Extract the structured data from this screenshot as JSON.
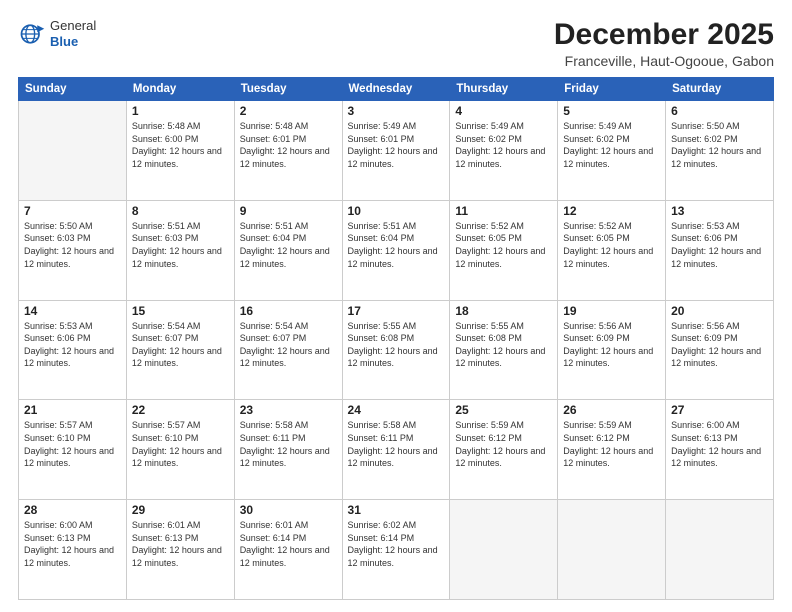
{
  "header": {
    "logo": {
      "general": "General",
      "blue": "Blue"
    },
    "title": "December 2025",
    "subtitle": "Franceville, Haut-Ogooue, Gabon"
  },
  "days_of_week": [
    "Sunday",
    "Monday",
    "Tuesday",
    "Wednesday",
    "Thursday",
    "Friday",
    "Saturday"
  ],
  "weeks": [
    [
      {
        "day": "",
        "empty": true
      },
      {
        "day": "1",
        "sunrise": "5:48 AM",
        "sunset": "6:00 PM",
        "daylight": "12 hours and 12 minutes."
      },
      {
        "day": "2",
        "sunrise": "5:48 AM",
        "sunset": "6:01 PM",
        "daylight": "12 hours and 12 minutes."
      },
      {
        "day": "3",
        "sunrise": "5:49 AM",
        "sunset": "6:01 PM",
        "daylight": "12 hours and 12 minutes."
      },
      {
        "day": "4",
        "sunrise": "5:49 AM",
        "sunset": "6:02 PM",
        "daylight": "12 hours and 12 minutes."
      },
      {
        "day": "5",
        "sunrise": "5:49 AM",
        "sunset": "6:02 PM",
        "daylight": "12 hours and 12 minutes."
      },
      {
        "day": "6",
        "sunrise": "5:50 AM",
        "sunset": "6:02 PM",
        "daylight": "12 hours and 12 minutes."
      }
    ],
    [
      {
        "day": "7",
        "sunrise": "5:50 AM",
        "sunset": "6:03 PM",
        "daylight": "12 hours and 12 minutes."
      },
      {
        "day": "8",
        "sunrise": "5:51 AM",
        "sunset": "6:03 PM",
        "daylight": "12 hours and 12 minutes."
      },
      {
        "day": "9",
        "sunrise": "5:51 AM",
        "sunset": "6:04 PM",
        "daylight": "12 hours and 12 minutes."
      },
      {
        "day": "10",
        "sunrise": "5:51 AM",
        "sunset": "6:04 PM",
        "daylight": "12 hours and 12 minutes."
      },
      {
        "day": "11",
        "sunrise": "5:52 AM",
        "sunset": "6:05 PM",
        "daylight": "12 hours and 12 minutes."
      },
      {
        "day": "12",
        "sunrise": "5:52 AM",
        "sunset": "6:05 PM",
        "daylight": "12 hours and 12 minutes."
      },
      {
        "day": "13",
        "sunrise": "5:53 AM",
        "sunset": "6:06 PM",
        "daylight": "12 hours and 12 minutes."
      }
    ],
    [
      {
        "day": "14",
        "sunrise": "5:53 AM",
        "sunset": "6:06 PM",
        "daylight": "12 hours and 12 minutes."
      },
      {
        "day": "15",
        "sunrise": "5:54 AM",
        "sunset": "6:07 PM",
        "daylight": "12 hours and 12 minutes."
      },
      {
        "day": "16",
        "sunrise": "5:54 AM",
        "sunset": "6:07 PM",
        "daylight": "12 hours and 12 minutes."
      },
      {
        "day": "17",
        "sunrise": "5:55 AM",
        "sunset": "6:08 PM",
        "daylight": "12 hours and 12 minutes."
      },
      {
        "day": "18",
        "sunrise": "5:55 AM",
        "sunset": "6:08 PM",
        "daylight": "12 hours and 12 minutes."
      },
      {
        "day": "19",
        "sunrise": "5:56 AM",
        "sunset": "6:09 PM",
        "daylight": "12 hours and 12 minutes."
      },
      {
        "day": "20",
        "sunrise": "5:56 AM",
        "sunset": "6:09 PM",
        "daylight": "12 hours and 12 minutes."
      }
    ],
    [
      {
        "day": "21",
        "sunrise": "5:57 AM",
        "sunset": "6:10 PM",
        "daylight": "12 hours and 12 minutes."
      },
      {
        "day": "22",
        "sunrise": "5:57 AM",
        "sunset": "6:10 PM",
        "daylight": "12 hours and 12 minutes."
      },
      {
        "day": "23",
        "sunrise": "5:58 AM",
        "sunset": "6:11 PM",
        "daylight": "12 hours and 12 minutes."
      },
      {
        "day": "24",
        "sunrise": "5:58 AM",
        "sunset": "6:11 PM",
        "daylight": "12 hours and 12 minutes."
      },
      {
        "day": "25",
        "sunrise": "5:59 AM",
        "sunset": "6:12 PM",
        "daylight": "12 hours and 12 minutes."
      },
      {
        "day": "26",
        "sunrise": "5:59 AM",
        "sunset": "6:12 PM",
        "daylight": "12 hours and 12 minutes."
      },
      {
        "day": "27",
        "sunrise": "6:00 AM",
        "sunset": "6:13 PM",
        "daylight": "12 hours and 12 minutes."
      }
    ],
    [
      {
        "day": "28",
        "sunrise": "6:00 AM",
        "sunset": "6:13 PM",
        "daylight": "12 hours and 12 minutes."
      },
      {
        "day": "29",
        "sunrise": "6:01 AM",
        "sunset": "6:13 PM",
        "daylight": "12 hours and 12 minutes."
      },
      {
        "day": "30",
        "sunrise": "6:01 AM",
        "sunset": "6:14 PM",
        "daylight": "12 hours and 12 minutes."
      },
      {
        "day": "31",
        "sunrise": "6:02 AM",
        "sunset": "6:14 PM",
        "daylight": "12 hours and 12 minutes."
      },
      {
        "day": "",
        "empty": true
      },
      {
        "day": "",
        "empty": true
      },
      {
        "day": "",
        "empty": true
      }
    ]
  ],
  "labels": {
    "sunrise": "Sunrise:",
    "sunset": "Sunset:",
    "daylight": "Daylight:"
  }
}
